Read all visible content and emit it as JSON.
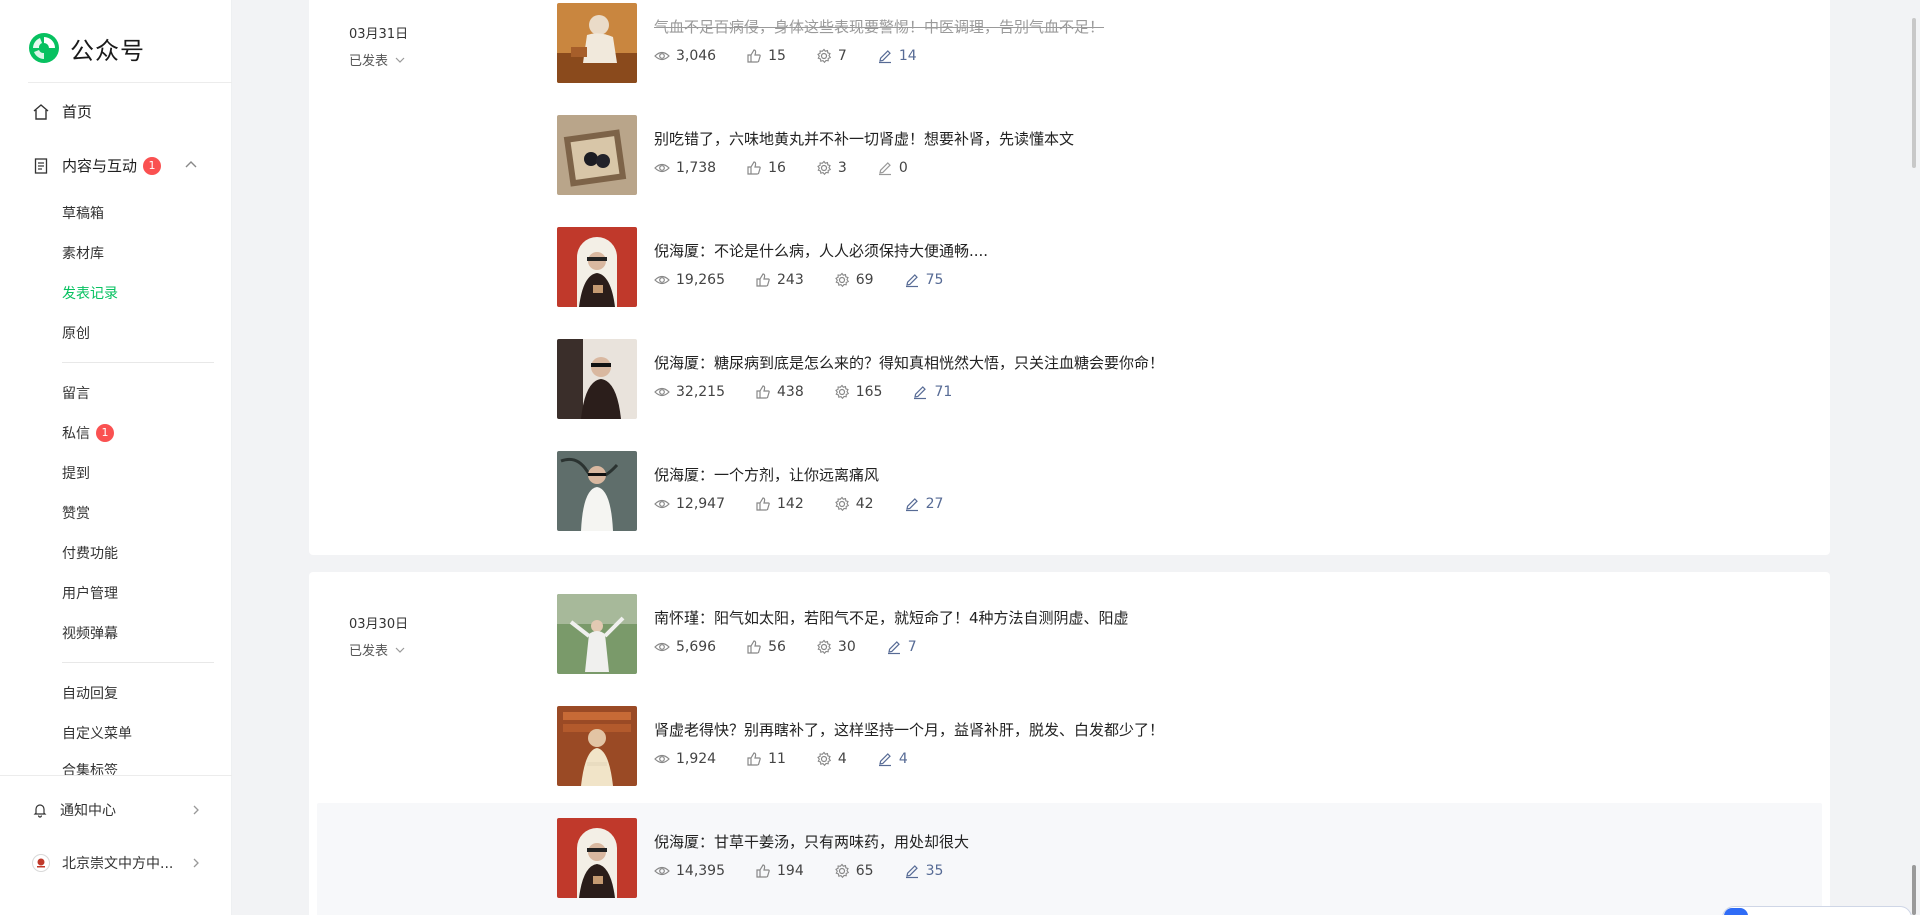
{
  "brand": {
    "name": "公众号"
  },
  "sidebar": {
    "home": "首页",
    "content": {
      "label": "内容与互动",
      "badge": "1"
    },
    "sub_items": [
      "草稿箱",
      "素材库",
      "发表记录",
      "原创"
    ],
    "interact_items": [
      "留言",
      "私信",
      "提到",
      "赞赏",
      "付费功能",
      "用户管理",
      "视频弹幕"
    ],
    "private_badge": "1",
    "tool_items": [
      "自动回复",
      "自定义菜单",
      "合集标签"
    ],
    "notification": "通知中心",
    "account": "北京崇文中方中..."
  },
  "groups": [
    {
      "date": "03月31日",
      "status": "已发表",
      "articles": [
        {
          "title": "气血不足百病侵，身体这些表现要警惕！中医调理，告别气血不足！",
          "deleted": true,
          "views": "3,046",
          "likes": "15",
          "shares": "7",
          "edits": "14",
          "thumb": "elder-tea"
        },
        {
          "title": "别吃错了，六味地黄丸并不补一切肾虚！想要补肾，先读懂本文",
          "deleted": false,
          "views": "1,738",
          "likes": "16",
          "shares": "3",
          "edits": "0",
          "thumb": "pills"
        },
        {
          "title": "倪海厦：不论是什么病，人人必须保持大便通畅....",
          "deleted": false,
          "views": "19,265",
          "likes": "243",
          "shares": "69",
          "edits": "75",
          "thumb": "man-arch"
        },
        {
          "title": "倪海厦：糖尿病到底是怎么来的？得知真相恍然大悟，只关注血糖会要你命！",
          "deleted": false,
          "views": "32,215",
          "likes": "438",
          "shares": "165",
          "edits": "71",
          "thumb": "man-dark"
        },
        {
          "title": "倪海厦：一个方剂，让你远离痛风",
          "deleted": false,
          "views": "12,947",
          "likes": "142",
          "shares": "42",
          "edits": "27",
          "thumb": "man-white"
        }
      ]
    },
    {
      "date": "03月30日",
      "status": "已发表",
      "articles": [
        {
          "title": "南怀瑾：阳气如太阳，若阳气不足，就短命了！4种方法自测阴虚、阳虚",
          "deleted": false,
          "views": "5,696",
          "likes": "56",
          "shares": "30",
          "edits": "7",
          "thumb": "taichi"
        },
        {
          "title": "肾虚老得快？别再瞎补了，这样坚持一个月，益肾补肝，脱发、白发都少了！",
          "deleted": false,
          "views": "1,924",
          "likes": "11",
          "shares": "4",
          "edits": "4",
          "thumb": "man-library"
        },
        {
          "title": "倪海厦：甘草干姜汤，只有两味药，用处却很大",
          "deleted": false,
          "views": "14,395",
          "likes": "194",
          "shares": "65",
          "edits": "35",
          "thumb": "man-arch"
        }
      ]
    }
  ]
}
